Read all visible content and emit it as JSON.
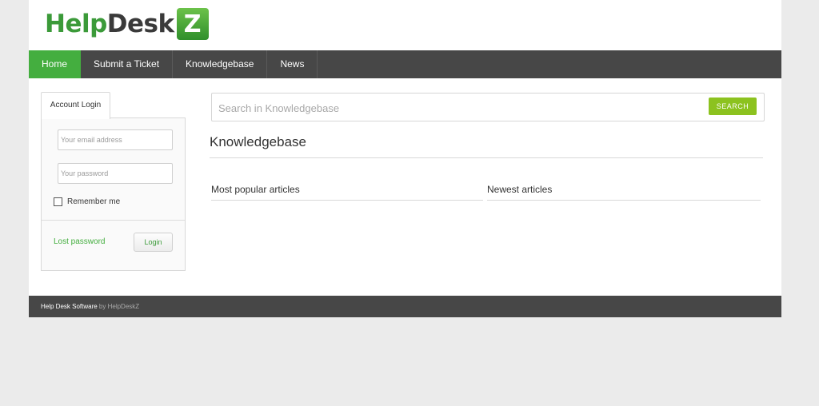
{
  "header": {
    "logo": {
      "part1": "Help",
      "part2": "Desk",
      "box": "Z"
    }
  },
  "nav": {
    "items": [
      {
        "label": "Home",
        "active": true
      },
      {
        "label": "Submit a Ticket",
        "active": false
      },
      {
        "label": "Knowledgebase",
        "active": false
      },
      {
        "label": "News",
        "active": false
      }
    ]
  },
  "login": {
    "tab_label": "Account Login",
    "email_placeholder": "Your email address",
    "password_placeholder": "Your password",
    "remember_label": "Remember me",
    "remember_checked": false,
    "lost_password": "Lost password",
    "login_button": "Login"
  },
  "search": {
    "placeholder": "Search in Knowledgebase",
    "button": "SEARCH"
  },
  "main": {
    "title": "Knowledgebase",
    "popular_title": "Most popular articles",
    "newest_title": "Newest articles"
  },
  "footer": {
    "text": "Help Desk Software",
    "by": " by HelpDeskZ"
  },
  "colors": {
    "accent_green": "#44ae3f",
    "search_button": "#8cc21f",
    "nav_bg": "#474747"
  }
}
